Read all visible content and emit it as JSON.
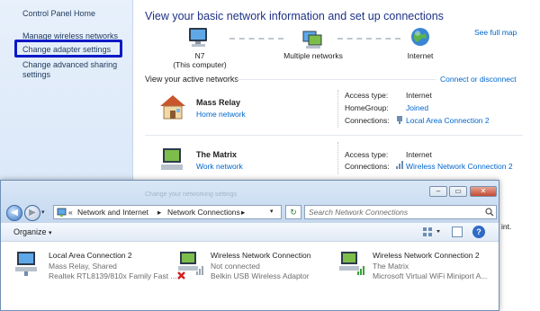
{
  "sidebar": {
    "home": "Control Panel Home",
    "items": [
      {
        "label": "Manage wireless networks"
      },
      {
        "label": "Change adapter settings"
      },
      {
        "label": "Change advanced sharing"
      },
      {
        "label": "settings"
      }
    ]
  },
  "main": {
    "title": "View your basic network information and set up connections",
    "see_full_map": "See full map",
    "map": {
      "computer": "N7",
      "computer_sub": "(This computer)",
      "middle": "Multiple networks",
      "internet": "Internet"
    },
    "active_header": "View your active networks",
    "connect_link": "Connect or disconnect",
    "networks": [
      {
        "name": "Mass Relay",
        "type": "Home network",
        "access_label": "Access type:",
        "access_value": "Internet",
        "homegroup_label": "HomeGroup:",
        "homegroup_value": "Joined",
        "connections_label": "Connections:",
        "connections_value": "Local Area Connection 2"
      },
      {
        "name": "The Matrix",
        "type": "Work network",
        "access_label": "Access type:",
        "access_value": "Internet",
        "connections_label": "Connections:",
        "connections_value": "Wireless Network Connection 2"
      }
    ],
    "change_settings_fragment": "Change your networking settings",
    "print_fragment": "int."
  },
  "nc_window": {
    "breadcrumb": [
      "Network and Internet",
      "Network Connections"
    ],
    "search_placeholder": "Search Network Connections",
    "organize": "Organize",
    "adapters": [
      {
        "name": "Local Area Connection 2",
        "line2": "Mass Relay, Shared",
        "line3": "Realtek RTL8139/810x Family Fast ..."
      },
      {
        "name": "Wireless Network Connection",
        "line2": "Not connected",
        "line3": "Belkin USB Wireless Adaptor"
      },
      {
        "name": "Wireless Network Connection 2",
        "line2": "The Matrix",
        "line3": "Microsoft Virtual WiFi Miniport A..."
      }
    ]
  },
  "colors": {
    "highlight_box": "#0a19c6",
    "link": "#0066cc",
    "title": "#1e3287"
  }
}
